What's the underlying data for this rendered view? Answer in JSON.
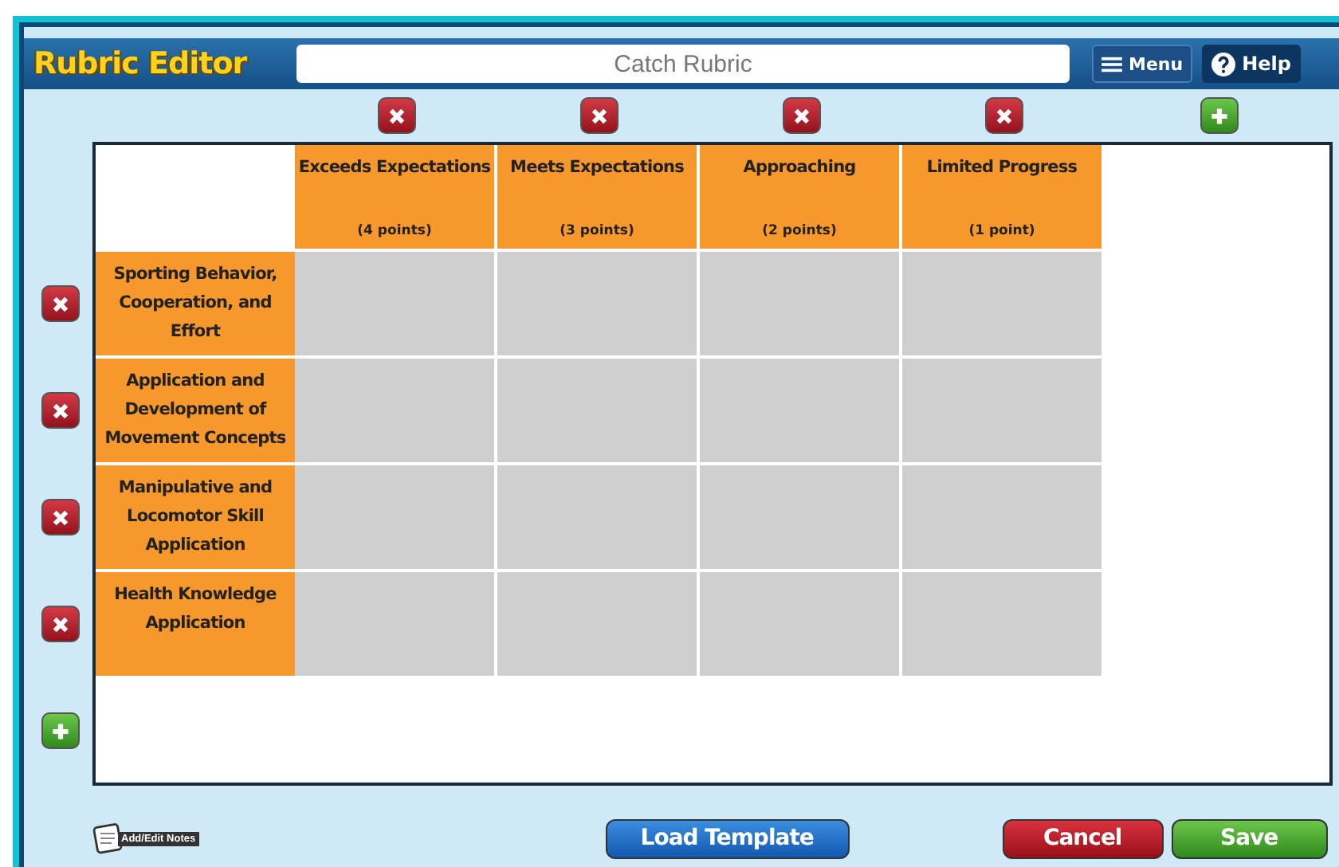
{
  "window": {
    "title": "Rubric Editor"
  },
  "rubric_name": {
    "value": "Catch Rubric"
  },
  "header_buttons": [
    {
      "kind": "menu",
      "label": "Menu"
    },
    {
      "kind": "help",
      "label": "Help"
    }
  ],
  "columns": [
    {
      "title": "Exceeds Expectations",
      "points": "(4 points)"
    },
    {
      "title": "Meets Expectations",
      "points": "(3 points)"
    },
    {
      "title": "Approaching",
      "points": "(2 points)"
    },
    {
      "title": "Limited Progress",
      "points": "(1 point)"
    }
  ],
  "rows": [
    {
      "label": "Sporting Behavior, Cooperation, and Effort"
    },
    {
      "label": "Application and Development of Movement Concepts"
    },
    {
      "label": "Manipulative and Locomotor Skill Application"
    },
    {
      "label": "Health Knowledge Application"
    }
  ],
  "notes_button": {
    "label": "Add/Edit Notes"
  },
  "footer_buttons": [
    {
      "kind": "template",
      "label": "Load Template"
    },
    {
      "kind": "cancel",
      "label": "Cancel"
    },
    {
      "kind": "save",
      "label": "Save"
    }
  ]
}
